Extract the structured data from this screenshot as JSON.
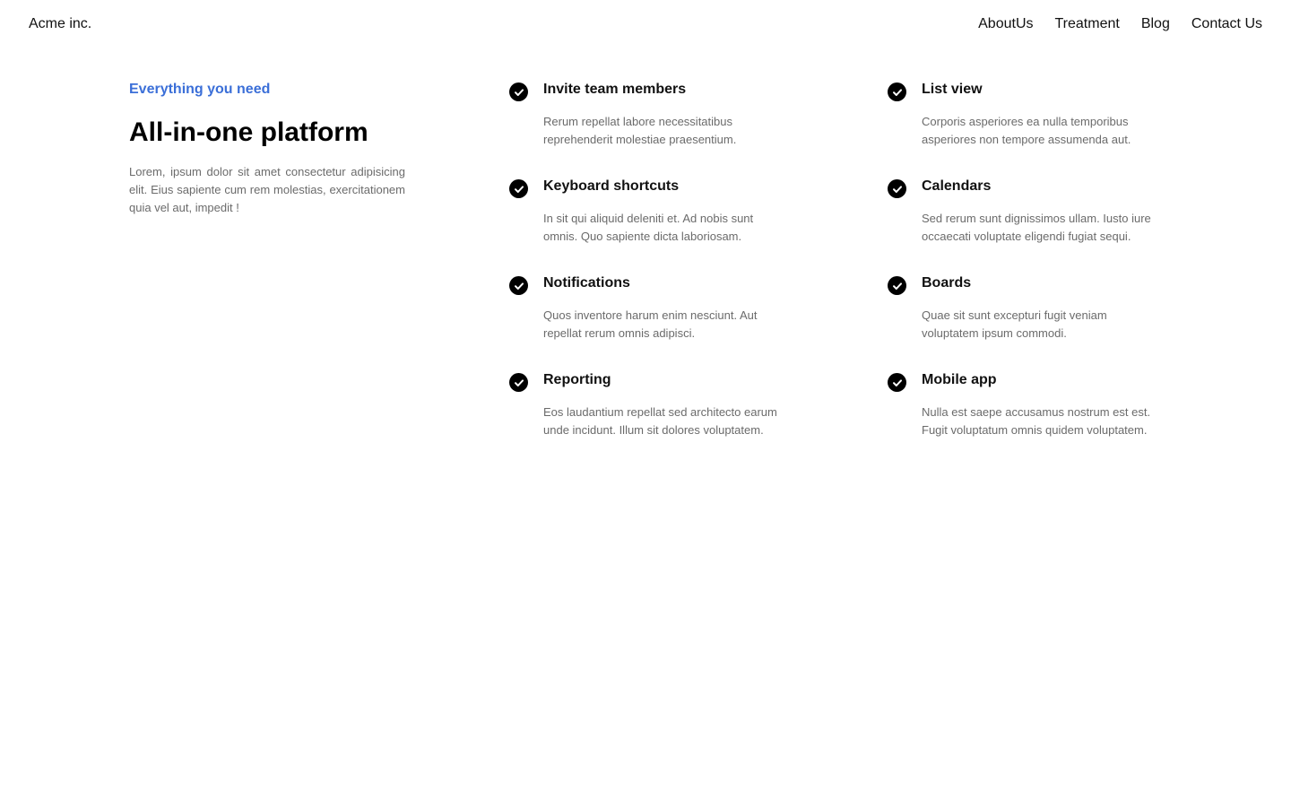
{
  "nav": {
    "brand": "Acme inc.",
    "links": [
      "AboutUs",
      "Treatment",
      "Blog",
      "Contact Us"
    ]
  },
  "intro": {
    "eyebrow": "Everything you need",
    "headline": "All-in-one platform",
    "text": "Lorem, ipsum dolor sit amet consectetur adipisicing elit. Eius sapiente cum rem molestias, exercitationem quia vel aut, impedit !"
  },
  "colors": {
    "accent": "#3b6fd8",
    "muted_text": "#6b6b6b",
    "icon_bg": "#000000"
  },
  "features": {
    "col1": [
      {
        "icon": "check-circle-icon",
        "title": "Invite team members",
        "desc": "Rerum repellat labore necessitatibus reprehenderit molestiae praesentium."
      },
      {
        "icon": "check-circle-icon",
        "title": "Keyboard shortcuts",
        "desc": "In sit qui aliquid deleniti et. Ad nobis sunt omnis. Quo sapiente dicta laboriosam."
      },
      {
        "icon": "check-circle-icon",
        "title": "Notifications",
        "desc": "Quos inventore harum enim nesciunt. Aut repellat rerum omnis adipisci."
      },
      {
        "icon": "check-circle-icon",
        "title": "Reporting",
        "desc": "Eos laudantium repellat sed architecto earum unde incidunt. Illum sit dolores voluptatem."
      }
    ],
    "col2": [
      {
        "icon": "check-circle-icon",
        "title": "List view",
        "desc": "Corporis asperiores ea nulla temporibus asperiores non tempore assumenda aut."
      },
      {
        "icon": "check-circle-icon",
        "title": "Calendars",
        "desc": "Sed rerum sunt dignissimos ullam. Iusto iure occaecati voluptate eligendi fugiat sequi."
      },
      {
        "icon": "check-circle-icon",
        "title": "Boards",
        "desc": "Quae sit sunt excepturi fugit veniam voluptatem ipsum commodi."
      },
      {
        "icon": "check-circle-icon",
        "title": "Mobile app",
        "desc": "Nulla est saepe accusamus nostrum est est. Fugit voluptatum omnis quidem voluptatem."
      }
    ]
  }
}
